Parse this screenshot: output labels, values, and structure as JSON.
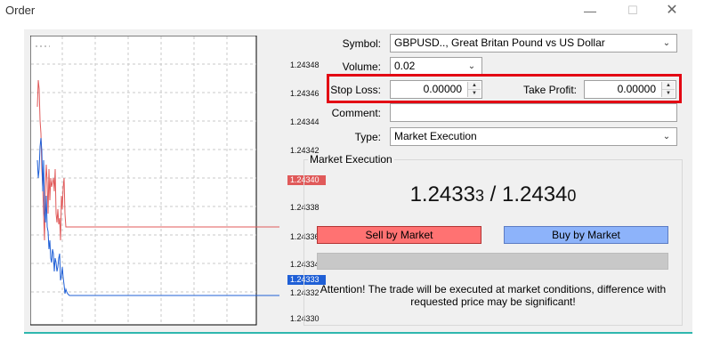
{
  "window": {
    "title": "Order",
    "minimize_glyph": "—",
    "maximize_glyph": "☐",
    "close_glyph": "✕"
  },
  "chart": {
    "tick_labels": [
      "1.24348",
      "1.24346",
      "1.24344",
      "1.24342",
      "1.24338",
      "1.24336",
      "1.24334",
      "1.24332",
      "1.24330"
    ],
    "ask_tag": "1.24340",
    "bid_tag": "1.24333",
    "colors": {
      "ask": "#e05a5a",
      "bid": "#1f5fd6",
      "grid": "#c8c8c8"
    }
  },
  "form": {
    "symbol_label": "Symbol:",
    "symbol_value": "GBPUSD.., Great Britan Pound vs US Dollar",
    "volume_label": "Volume:",
    "volume_value": "0.02",
    "stop_loss_label": "Stop Loss:",
    "stop_loss_value": "0.00000",
    "take_profit_label": "Take Profit:",
    "take_profit_value": "0.00000",
    "comment_label": "Comment:",
    "comment_value": "",
    "type_label": "Type:",
    "type_value": "Market Execution"
  },
  "market": {
    "group_title": "Market Execution",
    "bid_main": "1.2433",
    "bid_small": "3",
    "separator": " / ",
    "ask_main": "1.2434",
    "ask_small": "0",
    "sell_label": "Sell by Market",
    "buy_label": "Buy by Market",
    "attention": "Attention! The trade will be executed at market conditions, difference with requested price may be significant!"
  },
  "colors": {
    "highlight": "#e30613",
    "sell": "#ff7272",
    "buy": "#8db3fa",
    "accent": "#2fb7ae"
  }
}
